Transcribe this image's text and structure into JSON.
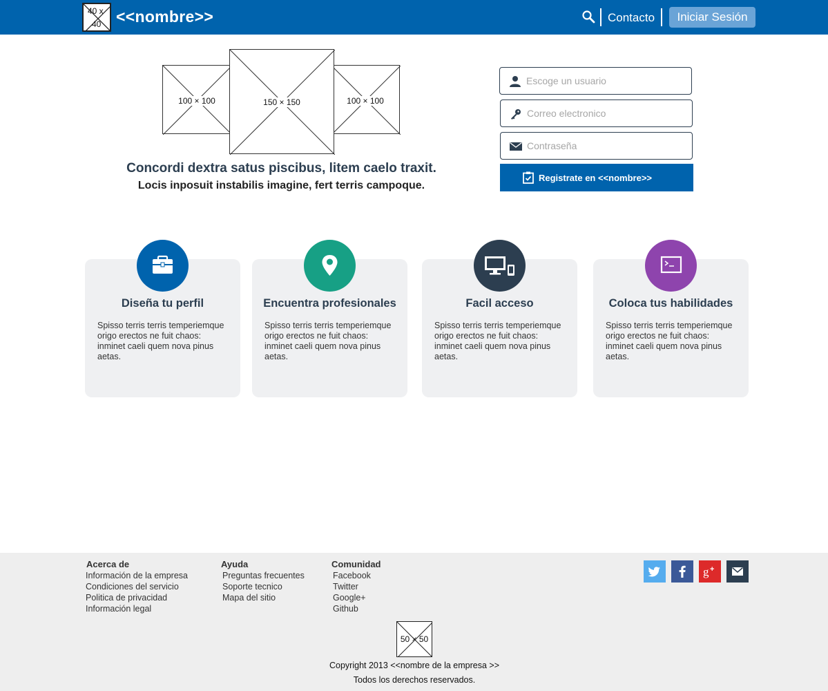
{
  "header": {
    "logo_placeholder_top": "40 x",
    "logo_placeholder_bottom": "40",
    "brand": "<<nombre>>",
    "contact": "Contacto",
    "login": "Iniciar Sesión"
  },
  "hero": {
    "image_left": "100 × 100",
    "image_center": "150 × 150",
    "image_right": "100 × 100",
    "title": "Concordi dextra satus piscibus, litem caelo traxit.",
    "subtitle": "Locis inposuit instabilis imagine, fert terris campoque."
  },
  "form": {
    "username_placeholder": "Escoge un usuario",
    "email_placeholder": "Correo electronico",
    "password_placeholder": "Contraseña",
    "register_label": "Registrate en <<nombre>>"
  },
  "features": [
    {
      "title": "Diseña tu perfil",
      "text": "Spisso  terris terris temperiemque origo erectos ne fuit chaos: inminet caeli quem nova pinus aetas.",
      "color": "#0063ad",
      "icon": "briefcase-icon"
    },
    {
      "title": "Encuentra profesionales",
      "text": "Spisso  terris terris temperiemque origo erectos ne fuit chaos: inminet caeli quem nova pinus aetas.",
      "color": "#17a085",
      "icon": "map-pin-icon"
    },
    {
      "title": "Facil acceso",
      "text": "Spisso  terris terris temperiemque origo erectos ne fuit chaos: inminet caeli quem nova pinus aetas.",
      "color": "#2c3e50",
      "icon": "devices-icon"
    },
    {
      "title": "Coloca tus habilidades",
      "text": "Spisso  terris terris temperiemque origo erectos ne fuit chaos: inminet caeli quem nova pinus aetas.",
      "color": "#8e44ad",
      "icon": "terminal-icon"
    }
  ],
  "footer": {
    "columns": [
      {
        "heading": "Acerca de",
        "links": [
          "Información de la empresa",
          "Condiciones del servicio",
          "Politica de privacidad",
          "Información legal"
        ]
      },
      {
        "heading": "Ayuda",
        "links": [
          "Preguntas frecuentes",
          "Soporte tecnico",
          "Mapa del sitio"
        ]
      },
      {
        "heading": "Comunidad",
        "links": [
          "Facebook",
          "Twitter",
          "Google+",
          "Github"
        ]
      }
    ],
    "social": [
      {
        "icon": "twitter-icon",
        "color": "#55acee"
      },
      {
        "icon": "facebook-icon",
        "color": "#3b5998"
      },
      {
        "icon": "google-plus-icon",
        "color": "#dd2a2a"
      },
      {
        "icon": "email-icon",
        "color": "#2c3e50"
      }
    ],
    "logo_placeholder": "50 × 50",
    "copyright": "Copyright 2013 <<nombre de la empresa >>",
    "rights": "Todos los derechos reservados."
  }
}
